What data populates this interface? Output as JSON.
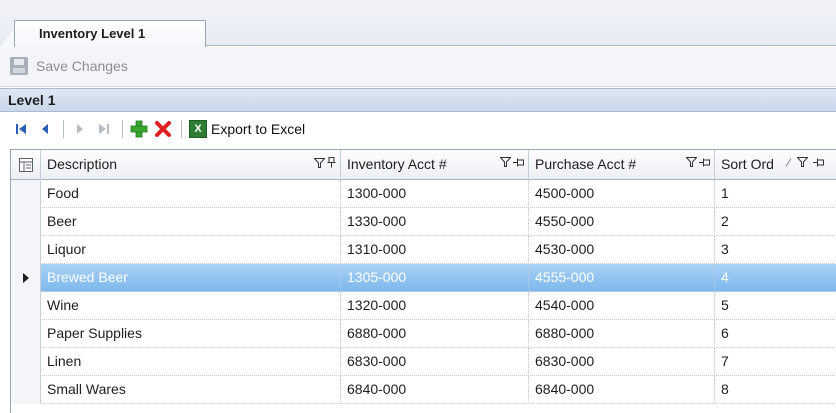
{
  "document_tab": {
    "label": "Inventory Level 1"
  },
  "toolbar": {
    "save_label": "Save Changes"
  },
  "level_header": {
    "title": "Level 1"
  },
  "nav": {
    "export_label": "Export to Excel"
  },
  "grid": {
    "columns": [
      {
        "label": "Description"
      },
      {
        "label": "Inventory Acct #"
      },
      {
        "label": "Purchase Acct #"
      },
      {
        "label": "Sort Ord"
      }
    ],
    "rows": [
      {
        "description": "Food",
        "inventory_acct": "1300-000",
        "purchase_acct": "4500-000",
        "sort_order": "1"
      },
      {
        "description": "Beer",
        "inventory_acct": "1330-000",
        "purchase_acct": "4550-000",
        "sort_order": "2"
      },
      {
        "description": "Liquor",
        "inventory_acct": "1310-000",
        "purchase_acct": "4530-000",
        "sort_order": "3"
      },
      {
        "description": "Brewed Beer",
        "inventory_acct": "1305-000",
        "purchase_acct": "4555-000",
        "sort_order": "4"
      },
      {
        "description": "Wine",
        "inventory_acct": "1320-000",
        "purchase_acct": "4540-000",
        "sort_order": "5"
      },
      {
        "description": "Paper Supplies",
        "inventory_acct": "6880-000",
        "purchase_acct": "6880-000",
        "sort_order": "6"
      },
      {
        "description": "Linen",
        "inventory_acct": "6830-000",
        "purchase_acct": "6830-000",
        "sort_order": "7"
      },
      {
        "description": "Small Wares",
        "inventory_acct": "6840-000",
        "purchase_acct": "6840-000",
        "sort_order": "8"
      }
    ],
    "selected_row_index": 3
  },
  "colors": {
    "selection": "#7db8ec",
    "add_icon": "#3aa52e",
    "delete_icon": "#e02020",
    "nav_icon": "#2c5fb3"
  }
}
